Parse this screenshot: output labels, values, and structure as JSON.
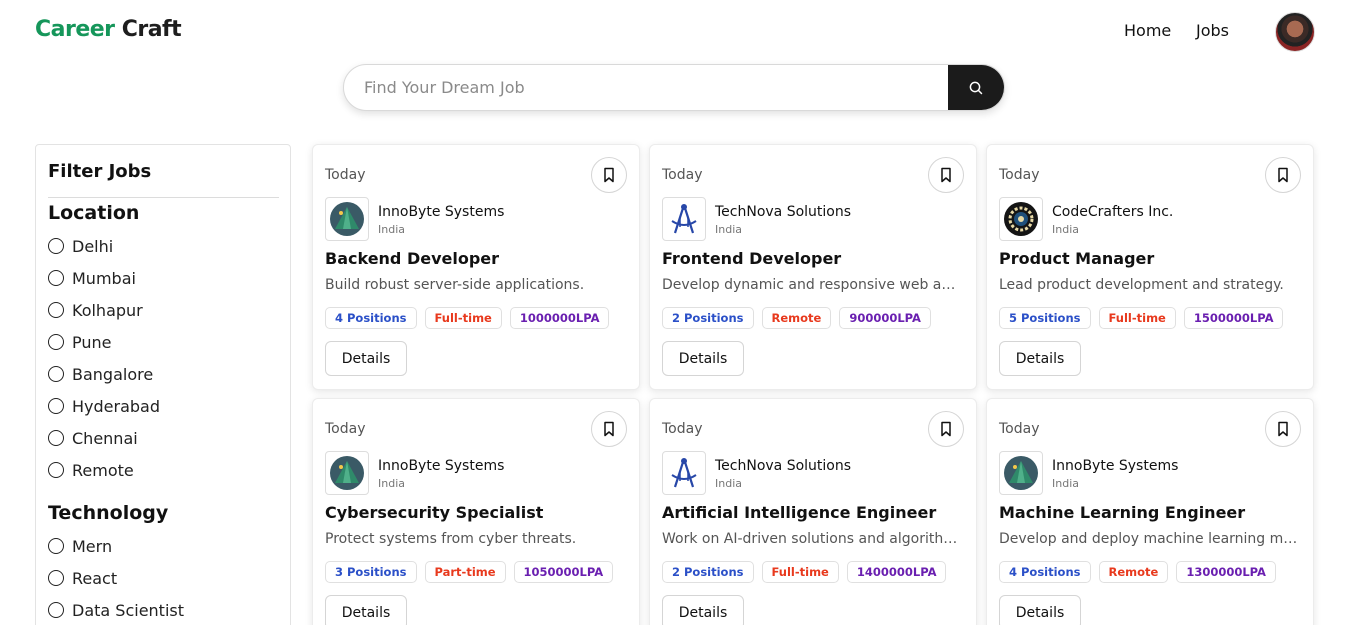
{
  "header": {
    "logo_part1": "Career",
    "logo_part2": "Craft",
    "nav": {
      "home": "Home",
      "jobs": "Jobs"
    }
  },
  "search": {
    "placeholder": "Find Your Dream Job",
    "value": ""
  },
  "sidebar": {
    "title": "Filter Jobs",
    "sections": [
      {
        "title": "Location",
        "options": [
          "Delhi",
          "Mumbai",
          "Kolhapur",
          "Pune",
          "Bangalore",
          "Hyderabad",
          "Chennai",
          "Remote"
        ]
      },
      {
        "title": "Technology",
        "options": [
          "Mern",
          "React",
          "Data Scientist"
        ]
      }
    ]
  },
  "jobs": [
    {
      "date": "Today",
      "company": "InnoByte Systems",
      "location": "India",
      "title": "Backend Developer",
      "description": "Build robust server-side applications.",
      "positions": "4 Positions",
      "type": "Full-time",
      "salary": "1000000LPA",
      "details_label": "Details",
      "logo": "pyramid-logo-icon"
    },
    {
      "date": "Today",
      "company": "TechNova Solutions",
      "location": "India",
      "title": "Frontend Developer",
      "description": "Develop dynamic and responsive web applications.",
      "positions": "2 Positions",
      "type": "Remote",
      "salary": "900000LPA",
      "details_label": "Details",
      "logo": "compass-logo-icon"
    },
    {
      "date": "Today",
      "company": "CodeCrafters Inc.",
      "location": "India",
      "title": "Product Manager",
      "description": "Lead product development and strategy.",
      "positions": "5 Positions",
      "type": "Full-time",
      "salary": "1500000LPA",
      "details_label": "Details",
      "logo": "gear-badge-logo-icon"
    },
    {
      "date": "Today",
      "company": "InnoByte Systems",
      "location": "India",
      "title": "Cybersecurity Specialist",
      "description": "Protect systems from cyber threats.",
      "positions": "3 Positions",
      "type": "Part-time",
      "salary": "1050000LPA",
      "details_label": "Details",
      "logo": "pyramid-logo-icon"
    },
    {
      "date": "Today",
      "company": "TechNova Solutions",
      "location": "India",
      "title": "Artificial Intelligence Engineer",
      "description": "Work on AI-driven solutions and algorithms.",
      "positions": "2 Positions",
      "type": "Full-time",
      "salary": "1400000LPA",
      "details_label": "Details",
      "logo": "compass-logo-icon"
    },
    {
      "date": "Today",
      "company": "InnoByte Systems",
      "location": "India",
      "title": "Machine Learning Engineer",
      "description": "Develop and deploy machine learning models.",
      "positions": "4 Positions",
      "type": "Remote",
      "salary": "1300000LPA",
      "details_label": "Details",
      "logo": "pyramid-logo-icon"
    }
  ],
  "colors": {
    "brand_green": "#15965a",
    "positions_blue": "#2b50c8",
    "type_red": "#e8391d",
    "salary_purple": "#6a1fb0"
  }
}
